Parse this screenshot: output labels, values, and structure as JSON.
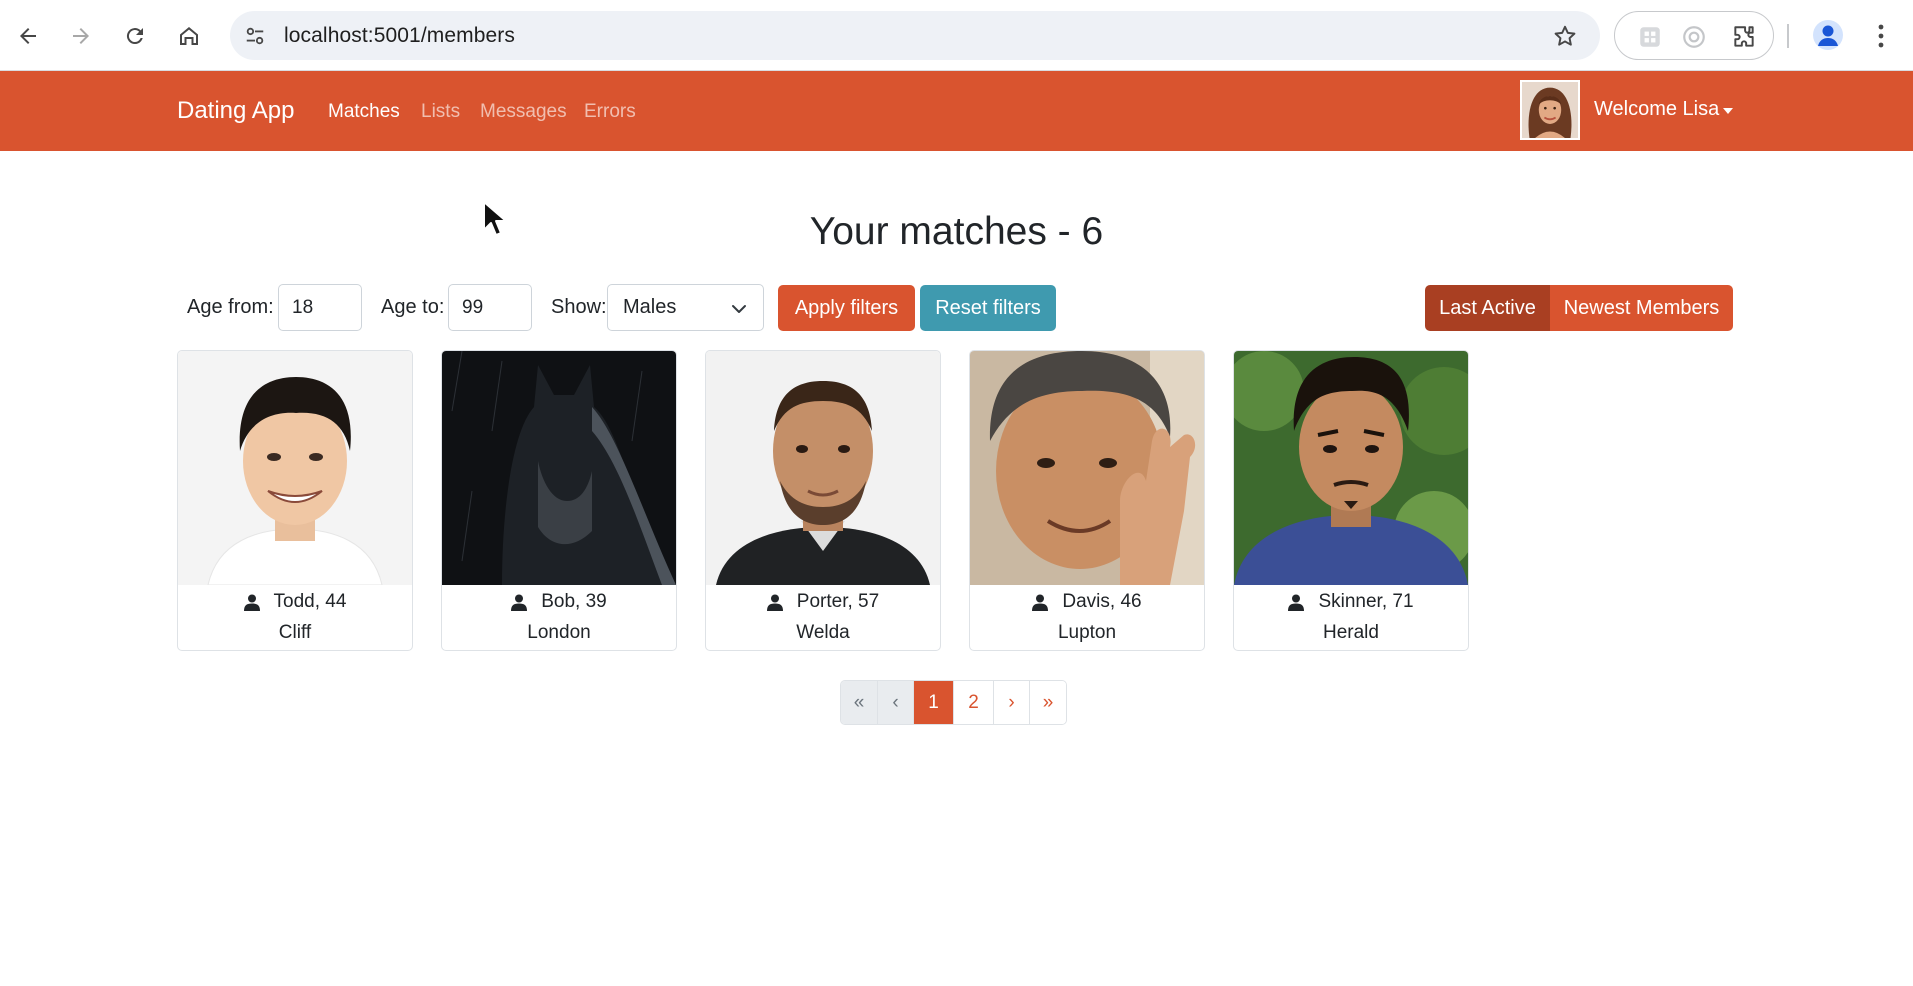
{
  "browser": {
    "url": "localhost:5001/members"
  },
  "navbar": {
    "brand": "Dating App",
    "links": [
      {
        "label": "Matches",
        "active": true
      },
      {
        "label": "Lists",
        "active": false
      },
      {
        "label": "Messages",
        "active": false
      },
      {
        "label": "Errors",
        "active": false
      }
    ],
    "welcome": "Welcome Lisa"
  },
  "page": {
    "title": "Your matches - 6"
  },
  "filters": {
    "age_from_label": "Age from:",
    "age_from_value": "18",
    "age_to_label": "Age to:",
    "age_to_value": "99",
    "show_label": "Show:",
    "show_value": "Males",
    "apply_label": "Apply filters",
    "reset_label": "Reset filters"
  },
  "sort": {
    "last_active_label": "Last Active",
    "newest_label": "Newest Members",
    "selected": "Last Active"
  },
  "members": [
    {
      "name_age": "Todd, 44",
      "city": "Cliff"
    },
    {
      "name_age": "Bob, 39",
      "city": "London"
    },
    {
      "name_age": "Porter, 57",
      "city": "Welda"
    },
    {
      "name_age": "Davis, 46",
      "city": "Lupton"
    },
    {
      "name_age": "Skinner, 71",
      "city": "Herald"
    }
  ],
  "pagination": {
    "first": "«",
    "prev": "‹",
    "pages": [
      "1",
      "2"
    ],
    "current": "1",
    "next": "›",
    "last": "»"
  },
  "colors": {
    "primary": "#d9542f",
    "primary_dark": "#a93f22",
    "info": "#3f9aaf"
  }
}
